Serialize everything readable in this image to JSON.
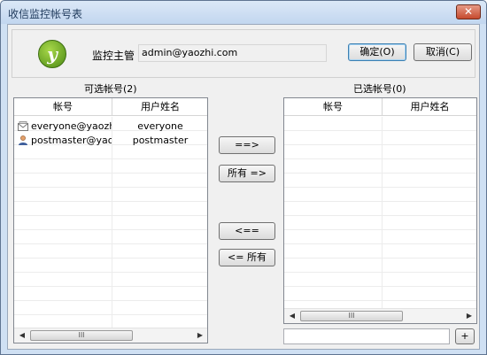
{
  "window": {
    "title": "收信监控帐号表",
    "close_glyph": "✕"
  },
  "top": {
    "logo_glyph": "y",
    "monitor_label": "监控主管",
    "monitor_value": "admin@yaozhi.com",
    "ok_label": "确定(O)",
    "cancel_label": "取消(C)"
  },
  "available": {
    "label": "可选帐号(2)",
    "columns": [
      "帐号",
      "用户姓名"
    ],
    "rows": [
      {
        "account": "everyone@yaozhi...",
        "name": "everyone",
        "icon": "group-mail-icon"
      },
      {
        "account": "postmaster@yaoz...",
        "name": "postmaster",
        "icon": "user-icon"
      }
    ]
  },
  "selected": {
    "label": "已选帐号(0)",
    "columns": [
      "帐号",
      "用户姓名"
    ],
    "rows": []
  },
  "transfer": {
    "add": "==>",
    "add_all": "所有 =>",
    "remove": "<==",
    "remove_all": "<= 所有"
  },
  "scroll": {
    "left_arrow": "◀",
    "right_arrow": "▶",
    "thumb_grip": "III"
  },
  "bottom": {
    "add_button": "+"
  }
}
